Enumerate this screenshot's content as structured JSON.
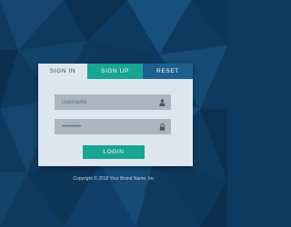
{
  "colors": {
    "background": "#0f3a5f",
    "card": "#dde6ee",
    "field": "#a9b6c2",
    "accent_green": "#18a592",
    "accent_blue": "#1f5f8f"
  },
  "tabs": {
    "signin": "SIGN IN",
    "signup": "SIGN UP",
    "reset": "RESET",
    "active": "signup"
  },
  "form": {
    "username_placeholder": "Username",
    "username_value": "",
    "password_value": "••••••••••",
    "username_icon": "user-icon",
    "password_icon": "lock-icon",
    "login_label": "LOGIN"
  },
  "footer": {
    "copyright": "Copyright © 2018 Your Brand Name, Inc"
  }
}
